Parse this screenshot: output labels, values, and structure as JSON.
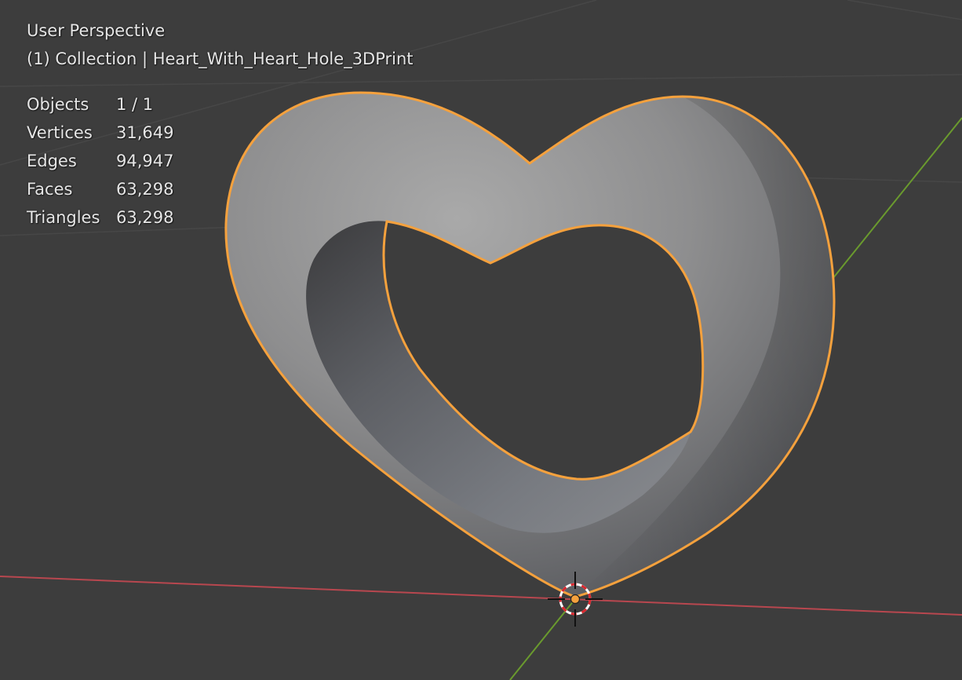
{
  "viewport": {
    "view_name": "User Perspective",
    "collection_line": "(1) Collection | Heart_With_Heart_Hole_3DPrint",
    "background_color": "#3d3d3d",
    "grid_line_color": "#474747",
    "x_axis_color": "#b8474f",
    "y_axis_color": "#6a9a2e",
    "selection_outline_color": "#f5a13d",
    "cursor_icon": "3d-cursor-icon",
    "origin_icon": "object-origin-icon"
  },
  "stats": [
    {
      "label": "Objects",
      "value": "1 / 1"
    },
    {
      "label": "Vertices",
      "value": "31,649"
    },
    {
      "label": "Edges",
      "value": "94,947"
    },
    {
      "label": "Faces",
      "value": "63,298"
    },
    {
      "label": "Triangles",
      "value": "63,298"
    }
  ],
  "object": {
    "shape": "heart-icon"
  }
}
